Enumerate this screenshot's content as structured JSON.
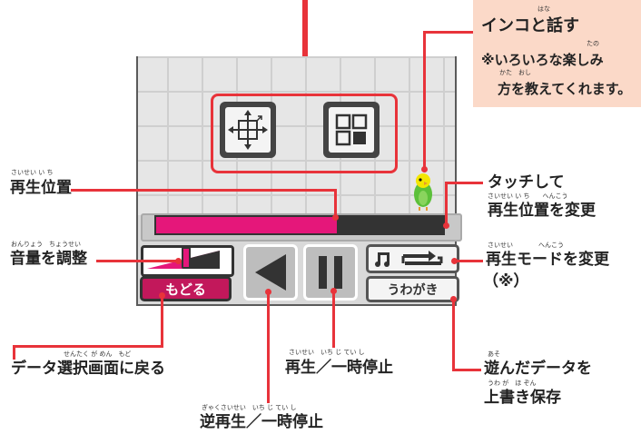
{
  "tip": {
    "title": "インコと話す",
    "title_ruby": "はな",
    "note_line1": "※いろいろな楽しみ",
    "note_line1_ruby": "たの",
    "note_line2": "方を教えてくれます。",
    "note_line2_ruby": "かた　おし"
  },
  "labels": {
    "seek_position": "再生位置",
    "seek_position_ruby": "さいせい い ち",
    "volume": "音量を調整",
    "volume_ruby": "おんりょう　ちょうせい",
    "touch_line1": "タッチして",
    "touch_line2": "再生位置を変更",
    "touch_line2_ruby": "さいせい い ち　　へんこう",
    "mode_line1": "再生モードを変更",
    "mode_line1_ruby": "さいせい　　　　へんこう",
    "mode_line2": "（※）",
    "back": "データ選択画面に戻る",
    "back_ruby": "せんたく が めん　もど",
    "play": "再生／一時停止",
    "play_ruby": "さいせい　いち じ てい し",
    "reverse": "逆再生／一時停止",
    "reverse_ruby": "ぎゃくさいせい　いち じ てい し",
    "save_line1": "遊んだデータを",
    "save_line1_ruby": "あそ",
    "save_line2": "上書き保存",
    "save_line2_ruby": "うわ が　ほ ぞん"
  },
  "controls": {
    "back_button": "もどる",
    "save_button": "うわがき",
    "seek_progress": 0.63,
    "volume_level": 0.55
  },
  "colors": {
    "accent_red": "#e8333a",
    "pink": "#e5177a",
    "tip_bg": "#fbd9c8"
  }
}
